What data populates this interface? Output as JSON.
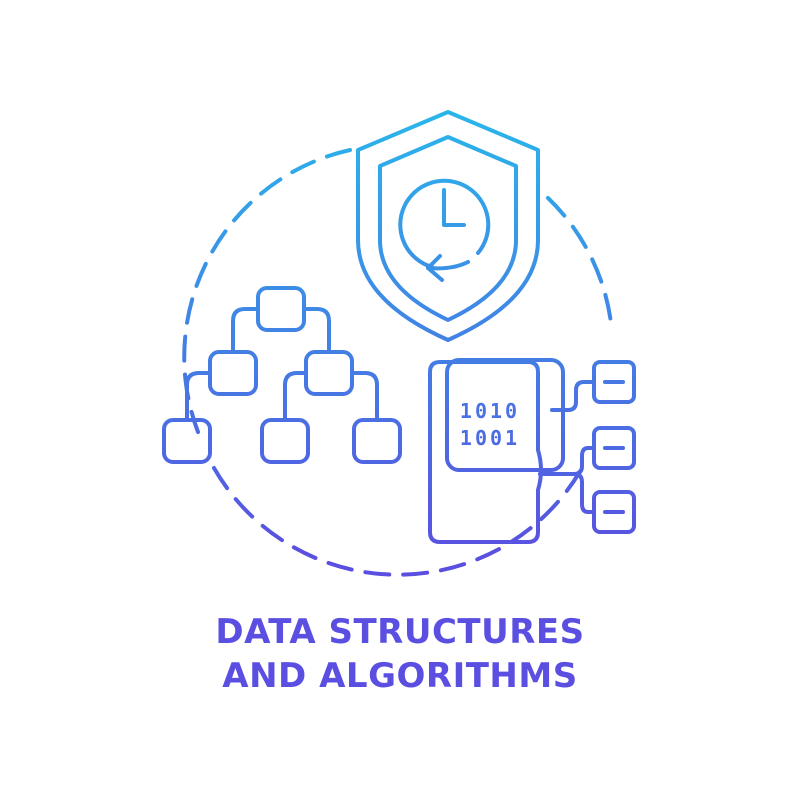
{
  "caption": {
    "line1": "DATA STRUCTURES",
    "line2": "AND ALGORITHMS"
  },
  "binary": {
    "row1": "1010",
    "row2": "1001"
  },
  "icons": [
    "dashed-circle",
    "shield-clock-icon",
    "tree-diagram-icon",
    "binary-file-icon",
    "linked-list-icon"
  ],
  "colors": {
    "gradient_top": "#29b6ea",
    "gradient_bottom": "#5a4fe0",
    "caption": "#5b4fe2",
    "background": "#ffffff"
  }
}
